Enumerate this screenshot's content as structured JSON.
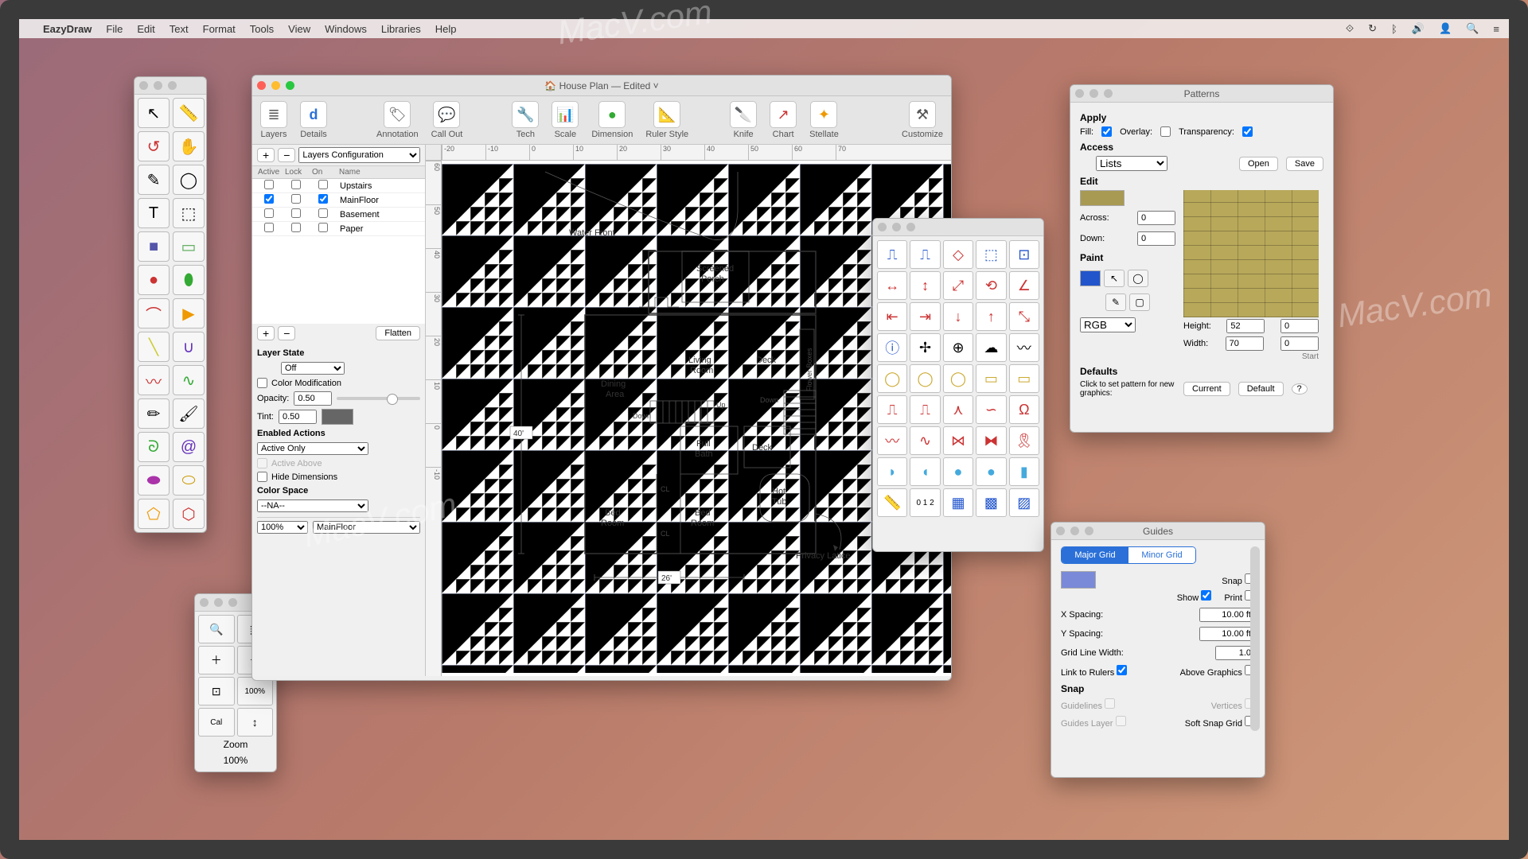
{
  "menubar": {
    "app": "EazyDraw",
    "items": [
      "File",
      "Edit",
      "Text",
      "Format",
      "Tools",
      "View",
      "Windows",
      "Libraries",
      "Help"
    ]
  },
  "doc": {
    "title": "House Plan — Edited ˅",
    "toolbar": {
      "layers": "Layers",
      "details": "Details",
      "annotation": "Annotation",
      "callout": "Call Out",
      "tech": "Tech",
      "scale": "Scale",
      "dimension": "Dimension",
      "rulerstyle": "Ruler Style",
      "knife": "Knife",
      "chart": "Chart",
      "stellate": "Stellate",
      "customize": "Customize"
    },
    "layers_panel": {
      "config_label": "Layers Configuration",
      "hdr_active": "Active",
      "hdr_lock": "Lock",
      "hdr_on": "On",
      "hdr_name": "Name",
      "rows": [
        {
          "active": false,
          "lock": false,
          "on": false,
          "name": "Upstairs"
        },
        {
          "active": true,
          "lock": false,
          "on": true,
          "name": "MainFloor"
        },
        {
          "active": false,
          "lock": false,
          "on": false,
          "name": "Basement"
        },
        {
          "active": false,
          "lock": false,
          "on": false,
          "name": "Paper"
        }
      ],
      "flatten": "Flatten",
      "state_title": "Layer State",
      "state_value": "Off",
      "colormod": "Color Modification",
      "opacity_label": "Opacity:",
      "opacity": "0.50",
      "tint_label": "Tint:",
      "tint": "0.50",
      "enabled_title": "Enabled Actions",
      "enabled_value": "Active Only",
      "active_above": "Active Above",
      "hide_dims": "Hide Dimensions",
      "colorspace_title": "Color Space",
      "colorspace_value": "--NA--",
      "zoom_pct": "100%",
      "current_layer": "MainFloor"
    },
    "ruler_h": [
      "-20",
      "-10",
      "0",
      "10",
      "20",
      "30",
      "40",
      "50",
      "60",
      "70"
    ],
    "ruler_v": [
      "60",
      "50",
      "40",
      "30",
      "20",
      "10",
      "0",
      "-10"
    ],
    "plan": {
      "water_front": "Water Front",
      "screened_porch_1": "Screened",
      "screened_porch_2": "Porch",
      "living_room_1": "Living",
      "living_room_2": "Room",
      "deck1": "Deck",
      "deck2": "Deck",
      "flower_boxes": "Flower Boxes",
      "dining_1": "Dining",
      "dining_2": "Area",
      "full_bath_1": "Full",
      "full_bath_2": "Bath",
      "hot_tub_1": "Hot",
      "hot_tub_2": "Tub",
      "bed1_1": "Bed",
      "bed1_2": "Room",
      "bed2_1": "Bed",
      "bed2_2": "Room",
      "privacy_latice": "Privacy Latice",
      "up": "Up",
      "down": "Down",
      "cl": "CL",
      "dim_40": "40'",
      "dim_26": "26'"
    }
  },
  "zoom_palette": {
    "title": "Zoom",
    "value": "100%"
  },
  "patterns": {
    "title": "Patterns",
    "apply": "Apply",
    "fill": "Fill:",
    "overlay": "Overlay:",
    "transparency": "Transparency:",
    "access": "Access",
    "lists": "Lists",
    "open": "Open",
    "save": "Save",
    "edit": "Edit",
    "across": "Across:",
    "across_v": "0",
    "down": "Down:",
    "down_v": "0",
    "paint": "Paint",
    "rgb": "RGB",
    "height": "Height:",
    "h1": "52",
    "h2": "0",
    "width": "Width:",
    "w1": "70",
    "w2": "0",
    "start": "Start",
    "defaults": "Defaults",
    "defaults_text": "Click to set pattern for new graphics:",
    "current": "Current",
    "default": "Default"
  },
  "guides": {
    "title": "Guides",
    "major": "Major Grid",
    "minor": "Minor Grid",
    "snap": "Snap",
    "show": "Show",
    "print": "Print",
    "xspacing": "X Spacing:",
    "xval": "10.00 ft",
    "yspacing": "Y Spacing:",
    "yval": "10.00 ft",
    "linewidth": "Grid Line Width:",
    "lwval": "1.0",
    "link_rulers": "Link to Rulers",
    "above_graphics": "Above Graphics",
    "snap_section": "Snap",
    "guidelines": "Guidelines",
    "vertices": "Vertices",
    "guides_layer": "Guides Layer",
    "soft_snap": "Soft Snap Grid"
  },
  "watermark": "MacV.com"
}
